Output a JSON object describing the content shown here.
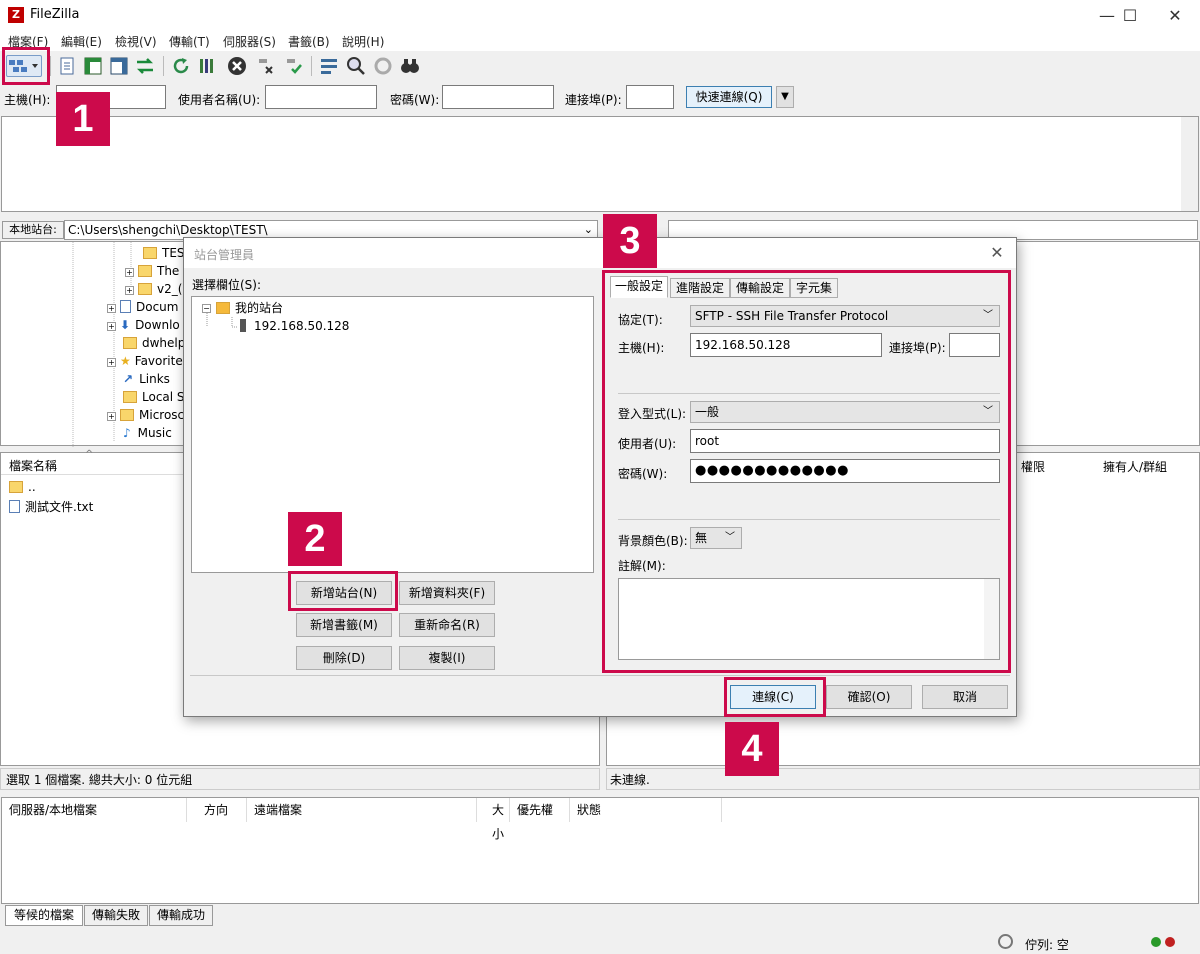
{
  "app": {
    "title": "FileZilla",
    "icon_letter": "Z"
  },
  "window_controls": {
    "minimize": "—",
    "maximize": "☐",
    "close": "✕"
  },
  "menu": [
    "檔案(F)",
    "編輯(E)",
    "檢視(V)",
    "傳輸(T)",
    "伺服器(S)",
    "書籤(B)",
    "說明(H)"
  ],
  "quickconnect": {
    "host_label": "主機(H):",
    "user_label": "使用者名稱(U):",
    "password_label": "密碼(W):",
    "port_label": "連接埠(P):",
    "button": "快速連線(Q)",
    "dropdown": "▼"
  },
  "local": {
    "path_label": "本地站台:",
    "path": "C:\\Users\\shengchi\\Desktop\\TEST\\",
    "tree": [
      "TES",
      "The",
      "v2_(",
      "Docum",
      "Downlo",
      "dwhelp",
      "Favorite",
      "Links",
      "Local S",
      "Microsc",
      "Music"
    ],
    "file_header": "檔案名稱",
    "files": [
      "..",
      "測試文件.txt"
    ],
    "status": "選取 1 個檔案. 總共大小: 0 位元組"
  },
  "remote": {
    "headers": [
      "權限",
      "擁有人/群組"
    ],
    "status": "未連線."
  },
  "queue": {
    "headers": [
      "伺服器/本地檔案",
      "方向",
      "遠端檔案",
      "大小",
      "優先權",
      "狀態"
    ],
    "tabs": [
      "等候的檔案",
      "傳輸失敗",
      "傳輸成功"
    ],
    "status": "佇列: 空"
  },
  "site_manager": {
    "title": "站台管理員",
    "close": "✕",
    "select_label": "選擇欄位(S):",
    "tree_root": "我的站台",
    "tree_site": "192.168.50.128",
    "buttons": {
      "new_site": "新增站台(N)",
      "new_folder": "新增資料夾(F)",
      "new_bookmark": "新增書籤(M)",
      "rename": "重新命名(R)",
      "delete": "刪除(D)",
      "copy": "複製(I)"
    },
    "tabs": [
      "一般設定",
      "進階設定",
      "傳輸設定",
      "字元集"
    ],
    "general": {
      "protocol_label": "協定(T):",
      "protocol_value": "SFTP - SSH File Transfer Protocol",
      "host_label": "主機(H):",
      "host_value": "192.168.50.128",
      "port_label": "連接埠(P):",
      "port_value": "",
      "logon_type_label": "登入型式(L):",
      "logon_type_value": "一般",
      "user_label": "使用者(U):",
      "user_value": "root",
      "password_label": "密碼(W):",
      "password_value": "●●●●●●●●●●●●●",
      "bg_color_label": "背景顏色(B):",
      "bg_color_value": "無",
      "comments_label": "註解(M):"
    },
    "footer": {
      "connect": "連線(C)",
      "ok": "確認(O)",
      "cancel": "取消"
    }
  },
  "annotations": [
    "1",
    "2",
    "3",
    "4"
  ],
  "colors": {
    "annotation": "#cc0a4b",
    "brand": "#bf0000"
  }
}
